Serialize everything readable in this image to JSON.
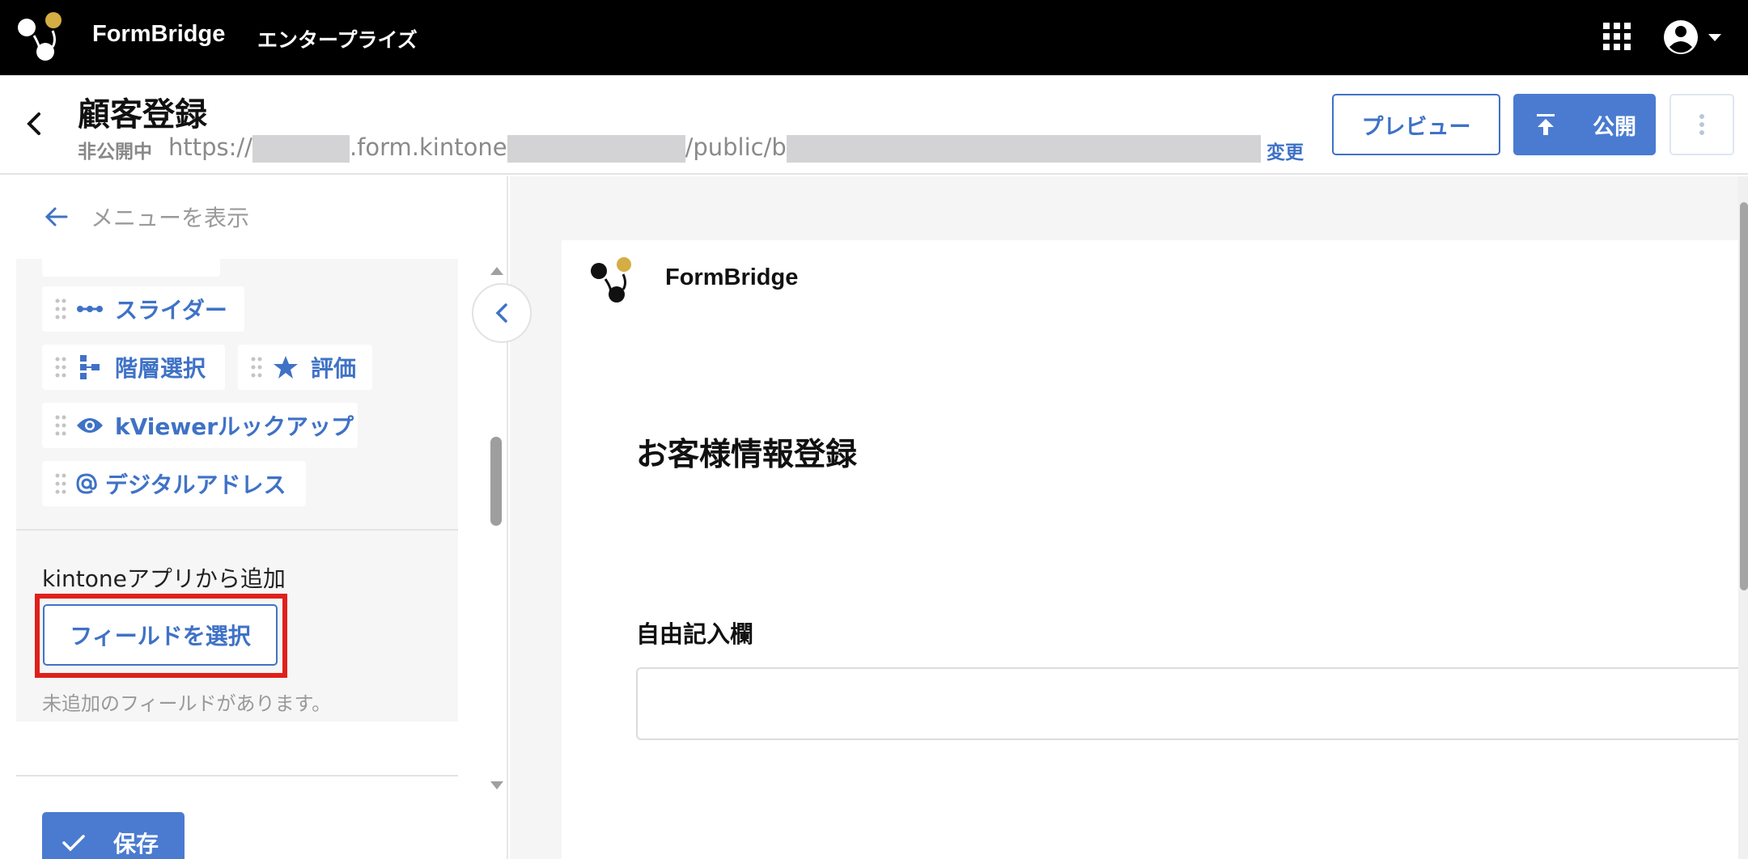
{
  "topbar": {
    "brand": "FormBridge",
    "edition": "エンタープライズ",
    "icons": {
      "logo": "formbridge-logo-icon",
      "apps": "apps-grid-icon",
      "user": "account-circle-icon",
      "dropdown": "caret-down-icon"
    },
    "colors": {
      "background": "#000000",
      "logo_accent": "#d4ad44"
    }
  },
  "header": {
    "title": "顧客登録",
    "status": "非公開中",
    "url": {
      "prefix": "https://",
      "part2": ".form.kintone",
      "part3": "/public/b"
    },
    "change_label": "変更",
    "preview_label": "プレビュー",
    "publish_label": "公開"
  },
  "left_panel": {
    "show_menu_label": "メニューを表示",
    "field_chips": [
      {
        "label": "スライダー",
        "icon": "slider-icon"
      },
      {
        "label": "階層選択",
        "icon": "hierarchy-icon"
      },
      {
        "label": "評価",
        "icon": "star-icon"
      },
      {
        "label": "kViewerルックアップ",
        "icon": "eye-icon"
      },
      {
        "label": "デジタルアドレス",
        "icon": "at-sign-icon"
      }
    ],
    "kintone_section": {
      "label": "kintoneアプリから追加",
      "select_button": "フィールドを選択",
      "hint": "未追加のフィールドがあります。"
    },
    "save_label": "保存"
  },
  "preview": {
    "brand": "FormBridge",
    "form_title": "お客様情報登録",
    "fields": [
      {
        "label": "自由記入欄",
        "value": ""
      }
    ]
  },
  "colors": {
    "accent": "#3f72c6",
    "primary_button": "#4a7bd0",
    "highlight": "#e0201b"
  }
}
